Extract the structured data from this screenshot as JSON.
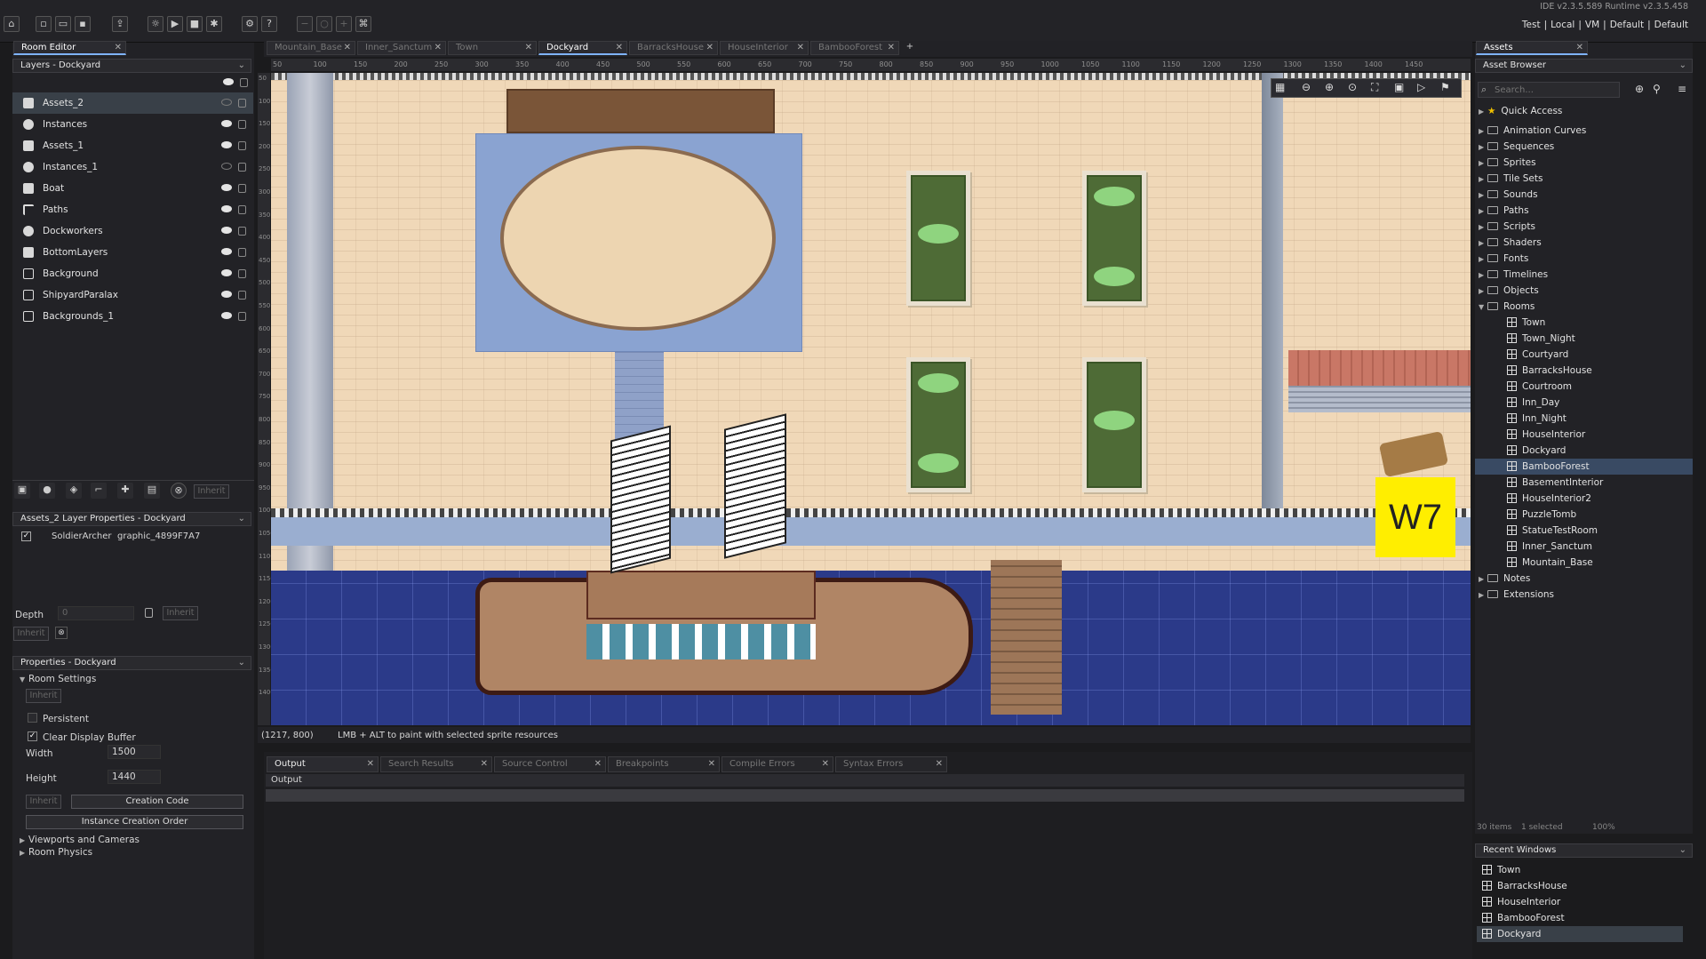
{
  "version": "IDE v2.3.5.589  Runtime v2.3.5.458",
  "configs": [
    "Test",
    "|",
    "Local",
    "|",
    "VM",
    "|",
    "Default",
    "|",
    "Default"
  ],
  "room_editor": {
    "tab": "Room Editor",
    "layers_dropdown": "Layers - Dockyard",
    "layers": [
      {
        "name": "Assets_2",
        "icon": "asset-layer-icon",
        "visible": false
      },
      {
        "name": "Instances",
        "icon": "instance-layer-icon",
        "visible": true
      },
      {
        "name": "Assets_1",
        "icon": "asset-layer-icon",
        "visible": true
      },
      {
        "name": "Instances_1",
        "icon": "instance-layer-icon",
        "visible": false
      },
      {
        "name": "Boat",
        "icon": "asset-layer-icon",
        "visible": true
      },
      {
        "name": "Paths",
        "icon": "path-layer-icon",
        "visible": true
      },
      {
        "name": "Dockworkers",
        "icon": "instance-layer-icon",
        "visible": true
      },
      {
        "name": "BottomLayers",
        "icon": "asset-layer-icon",
        "visible": true
      },
      {
        "name": "Background",
        "icon": "background-layer-icon",
        "visible": true
      },
      {
        "name": "ShipyardParalax",
        "icon": "background-layer-icon",
        "visible": true
      },
      {
        "name": "Backgrounds_1",
        "icon": "background-layer-icon",
        "visible": true
      }
    ],
    "inherit": "Inherit",
    "layer_props_title": "Assets_2 Layer Properties - Dockyard",
    "asset_entry": {
      "name": "SoldierArcher",
      "graphic": "graphic_4899F7A7"
    },
    "depth_label": "Depth",
    "depth_value": "0",
    "props_title": "Properties - Dockyard",
    "room_settings": "Room Settings",
    "persistent": "Persistent",
    "clear_display": "Clear Display Buffer",
    "width_label": "Width",
    "width_value": "1500",
    "height_label": "Height",
    "height_value": "1440",
    "creation_code": "Creation Code",
    "instance_order": "Instance Creation Order",
    "viewports": "Viewports and Cameras",
    "physics": "Room Physics"
  },
  "doc_tabs": [
    "Mountain_Base",
    "Inner_Sanctum",
    "Town",
    "Dockyard",
    "BarracksHouse",
    "HouseInterior",
    "BambooForest"
  ],
  "active_doc": "Dockyard",
  "ruler_top": [
    "50",
    "100",
    "150",
    "200",
    "250",
    "300",
    "350",
    "400",
    "450",
    "500",
    "550",
    "600",
    "650",
    "700",
    "750",
    "800",
    "850",
    "900",
    "950",
    "1000",
    "1050",
    "1100",
    "1150",
    "1200",
    "1250",
    "1300",
    "1350",
    "1400",
    "1450"
  ],
  "ruler_left": [
    "50",
    "100",
    "150",
    "200",
    "250",
    "300",
    "350",
    "400",
    "450",
    "500",
    "550",
    "600",
    "650",
    "700",
    "750",
    "800",
    "850",
    "900",
    "950",
    "1000",
    "1050",
    "1100",
    "1150",
    "1200",
    "1250",
    "1300",
    "1350",
    "1400"
  ],
  "status": {
    "coords": "(1217, 800)",
    "hint": "LMB + ALT to paint with selected sprite resources"
  },
  "watermark": "W7",
  "output_tabs": [
    "Output",
    "Search Results",
    "Source Control",
    "Breakpoints",
    "Compile Errors",
    "Syntax Errors"
  ],
  "output_header": "Output",
  "assets": {
    "tab": "Assets",
    "browser": "Asset Browser",
    "search_placeholder": "Search...",
    "quick_access": "Quick Access",
    "folders": [
      "Animation Curves",
      "Sequences",
      "Sprites",
      "Tile Sets",
      "Sounds",
      "Paths",
      "Scripts",
      "Shaders",
      "Fonts",
      "Timelines",
      "Objects"
    ],
    "rooms_folder": "Rooms",
    "rooms": [
      "Town",
      "Town_Night",
      "Courtyard",
      "BarracksHouse",
      "Courtroom",
      "Inn_Day",
      "Inn_Night",
      "HouseInterior",
      "Dockyard",
      "BambooForest",
      "BasementInterior",
      "HouseInterior2",
      "PuzzleTomb",
      "StatueTestRoom",
      "Inner_Sanctum",
      "Mountain_Base"
    ],
    "selected_room": "BambooForest",
    "after_folders": [
      "Notes",
      "Extensions"
    ],
    "footer_items": "30 items",
    "footer_selected": "1 selected",
    "footer_zoom": "100%"
  },
  "recent": {
    "title": "Recent Windows",
    "items": [
      "Town",
      "BarracksHouse",
      "HouseInterior",
      "BambooForest",
      "Dockyard"
    ],
    "selected": "Dockyard"
  }
}
